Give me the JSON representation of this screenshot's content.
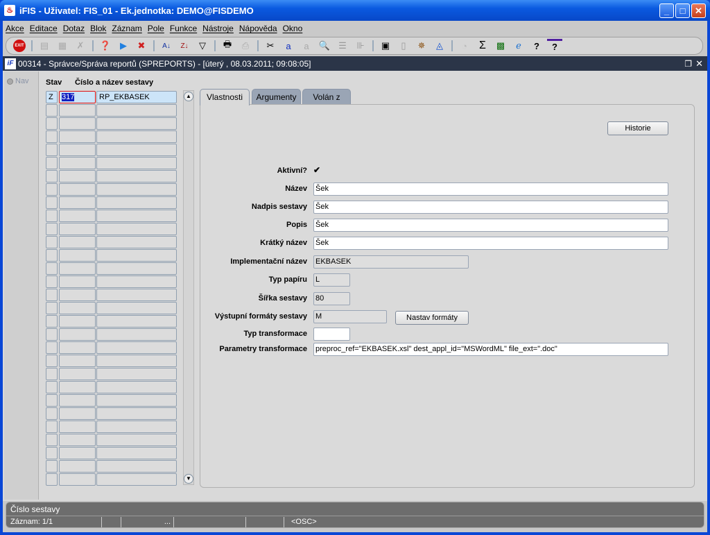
{
  "window": {
    "title": "iFIS - Uživatel: FIS_01 - Ek.jednotka: DEMO@FISDEMO",
    "minimize": "_",
    "maximize": "□",
    "close": "✕"
  },
  "menu": [
    "Akce",
    "Editace",
    "Dotaz",
    "Blok",
    "Záznam",
    "Pole",
    "Funkce",
    "Nástroje",
    "Nápověda",
    "Okno"
  ],
  "toolbar": {
    "exit": "EXIT"
  },
  "form": {
    "title": "00314 - Správce/Správa reportů (SPREPORTS) - [úterý  , 08.03.2011; 09:08:05]",
    "logo": "iF"
  },
  "nav": {
    "label": "Nav"
  },
  "grid": {
    "headers": {
      "stav": "Stav",
      "name": "Číslo a název sestavy"
    },
    "rows": [
      {
        "stav": "Z",
        "cislo": "317",
        "nazev": "RP_EKBASEK"
      }
    ],
    "row_count": 30
  },
  "tabs": [
    "Vlastnosti",
    "Argumenty",
    "Volán z"
  ],
  "props": {
    "historie": "Historie",
    "aktivni_label": "Aktivní?",
    "aktivni": "✔",
    "fields": [
      {
        "label": "Název",
        "value": "Šek"
      },
      {
        "label": "Nadpis sestavy",
        "value": "Šek"
      },
      {
        "label": "Popis",
        "value": "Šek"
      },
      {
        "label": "Krátký název",
        "value": "Šek"
      },
      {
        "label": "Implementační název",
        "value": "EKBASEK"
      },
      {
        "label": "Typ papíru",
        "value": "L"
      },
      {
        "label": "Šířka sestavy",
        "value": "80"
      },
      {
        "label": "Výstupní formáty sestavy",
        "value": "M"
      },
      {
        "label": "Typ transformace",
        "value": ""
      },
      {
        "label": "Parametry transformace",
        "value": "preproc_ref=\"EKBASEK.xsl\" dest_appl_id=\"MSWordML\" file_ext=\".doc\""
      }
    ],
    "nastav": "Nastav formáty"
  },
  "status": {
    "hint": "Číslo sestavy",
    "record": "Záznam: 1/1",
    "dots": "...",
    "mode": "<OSC>"
  }
}
